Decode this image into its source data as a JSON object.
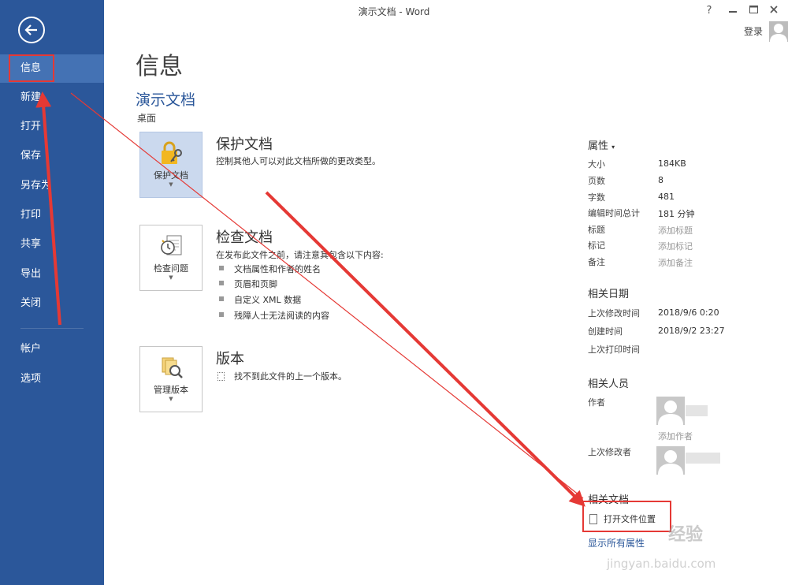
{
  "window": {
    "title": "演示文档 - Word",
    "help": "?",
    "signin": "登录"
  },
  "sidebar": {
    "items": [
      {
        "label": "信息",
        "active": true
      },
      {
        "label": "新建"
      },
      {
        "label": "打开"
      },
      {
        "label": "保存"
      },
      {
        "label": "另存为"
      },
      {
        "label": "打印"
      },
      {
        "label": "共享"
      },
      {
        "label": "导出"
      },
      {
        "label": "关闭"
      },
      {
        "label": "帐户"
      },
      {
        "label": "选项"
      }
    ]
  },
  "main": {
    "title": "信息",
    "doc_name": "演示文档",
    "location": "桌面",
    "protect": {
      "tile_label": "保护文档",
      "title": "保护文档",
      "desc": "控制其他人可以对此文档所做的更改类型。"
    },
    "inspect": {
      "tile_label": "检查问题",
      "title": "检查文档",
      "desc": "在发布此文件之前，请注意其包含以下内容:",
      "bullets": [
        "文档属性和作者的姓名",
        "页眉和页脚",
        "自定义 XML 数据",
        "残障人士无法阅读的内容"
      ]
    },
    "versions": {
      "tile_label": "管理版本",
      "title": "版本",
      "desc": "找不到此文件的上一个版本。"
    }
  },
  "properties": {
    "header": "属性",
    "caret": "▾",
    "rows": [
      {
        "label": "大小",
        "value": "184KB"
      },
      {
        "label": "页数",
        "value": "8"
      },
      {
        "label": "字数",
        "value": "481"
      },
      {
        "label": "编辑时间总计",
        "value": "181 分钟"
      },
      {
        "label": "标题",
        "value": "添加标题"
      },
      {
        "label": "标记",
        "value": "添加标记"
      },
      {
        "label": "备注",
        "value": "添加备注"
      }
    ]
  },
  "dates": {
    "header": "相关日期",
    "rows": [
      {
        "label": "上次修改时间",
        "value": "2018/9/6 0:20"
      },
      {
        "label": "创建时间",
        "value": "2018/9/2 23:27"
      },
      {
        "label": "上次打印时间",
        "value": ""
      }
    ]
  },
  "people": {
    "header": "相关人员",
    "author_label": "作者",
    "add_author": "添加作者",
    "modifier_label": "上次修改者"
  },
  "related_docs": {
    "header": "相关文档",
    "open_location": "打开文件位置",
    "show_all": "显示所有属性"
  },
  "watermark": {
    "brand": "经验",
    "url": "jingyan.baidu.com"
  }
}
